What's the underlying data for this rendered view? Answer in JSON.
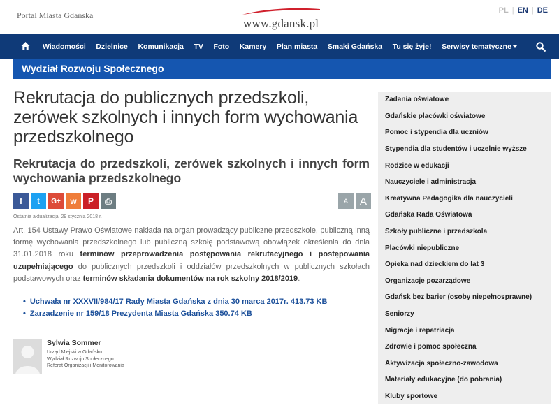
{
  "header": {
    "portal": "Portal Miasta Gdańska",
    "logo_text": "www.gdansk.pl",
    "languages": [
      "PL",
      "EN",
      "DE"
    ],
    "active_language": "PL"
  },
  "nav": {
    "home_icon": "home-icon",
    "items": [
      "Wiadomości",
      "Dzielnice",
      "Komunikacja",
      "TV",
      "Foto",
      "Kamery",
      "Plan miasta",
      "Smaki Gdańska",
      "Tu się żyje!",
      "Serwisy tematyczne"
    ],
    "search_icon": "search-icon"
  },
  "department": {
    "title": "Wydział Rozwoju Społecznego"
  },
  "article": {
    "title": "Rekrutacja do publicznych przedszkoli, zerówek szkolnych i innych form wychowania przedszkolnego",
    "subtitle": "Rekrutacja do przedszkoli, zerówek szkolnych i innych form wychowania przedszkolnego",
    "share_buttons": [
      {
        "icon": "facebook-icon",
        "glyph": "f"
      },
      {
        "icon": "twitter-icon",
        "glyph": "t"
      },
      {
        "icon": "google-plus-icon",
        "glyph": "G+"
      },
      {
        "icon": "wykop-icon",
        "glyph": "w"
      },
      {
        "icon": "pinterest-icon",
        "glyph": "P"
      },
      {
        "icon": "print-icon",
        "glyph": "⎙"
      }
    ],
    "font_small": "A",
    "font_large": "A",
    "updated": "Ostatnia aktualizacja: 29 stycznia 2018 r.",
    "body": {
      "p1": "Art. 154 Ustawy Prawo Oświatowe nakłada na organ prowadzący publiczne przedszkole, publiczną inną formę wychowania przedszkolnego lub publiczną szkołę podstawową obowiązek określenia do dnia 31.01.2018 roku ",
      "b1": "terminów przeprowadzenia postępowania rekrutacyjnego i postępowania uzupełniającego",
      "p2": " do publicznych przedszkoli i oddziałów przedszkolnych w publicznych szkołach podstawowych oraz ",
      "b2": "terminów składania dokumentów na rok szkolny 2018/2019",
      "p3": "."
    },
    "documents": [
      "Uchwała nr XXXVII/984/17 Rady Miasta Gdańska z dnia 30 marca 2017r. 413.73 KB",
      "Zarzadzenie nr 159/18 Prezydenta Miasta Gdańska 350.74 KB"
    ],
    "contact": {
      "name": "Sylwia Sommer",
      "lines": [
        "Urząd Miejski w Gdańsku",
        "Wydział Rozwoju Społecznego",
        "Referat Organizacji i Monitorowania"
      ]
    }
  },
  "sidebar": {
    "items": [
      "Zadania oświatowe",
      "Gdańskie placówki oświatowe",
      "Pomoc i stypendia dla uczniów",
      "Stypendia dla studentów i uczelnie wyższe",
      "Rodzice w edukacji",
      "Nauczyciele i administracja",
      "Kreatywna Pedagogika dla nauczycieli",
      "Gdańska Rada Oświatowa",
      "Szkoły publiczne i przedszkola",
      "Placówki niepubliczne",
      "Opieka nad dzieckiem do lat 3",
      "Organizacje pozarządowe",
      "Gdańsk bez barier (osoby niepełnosprawne)",
      "Seniorzy",
      "Migracje i repatriacja",
      "Zdrowie i pomoc społeczna",
      "Aktywizacja społeczno-zawodowa",
      "Materiały edukacyjne (do pobrania)",
      "Kluby sportowe"
    ]
  },
  "colors": {
    "nav_bg": "#0f3a78",
    "dept_bg": "#1556b0",
    "link": "#1b4f9a",
    "sidebar_bg": "#eeeeee"
  }
}
